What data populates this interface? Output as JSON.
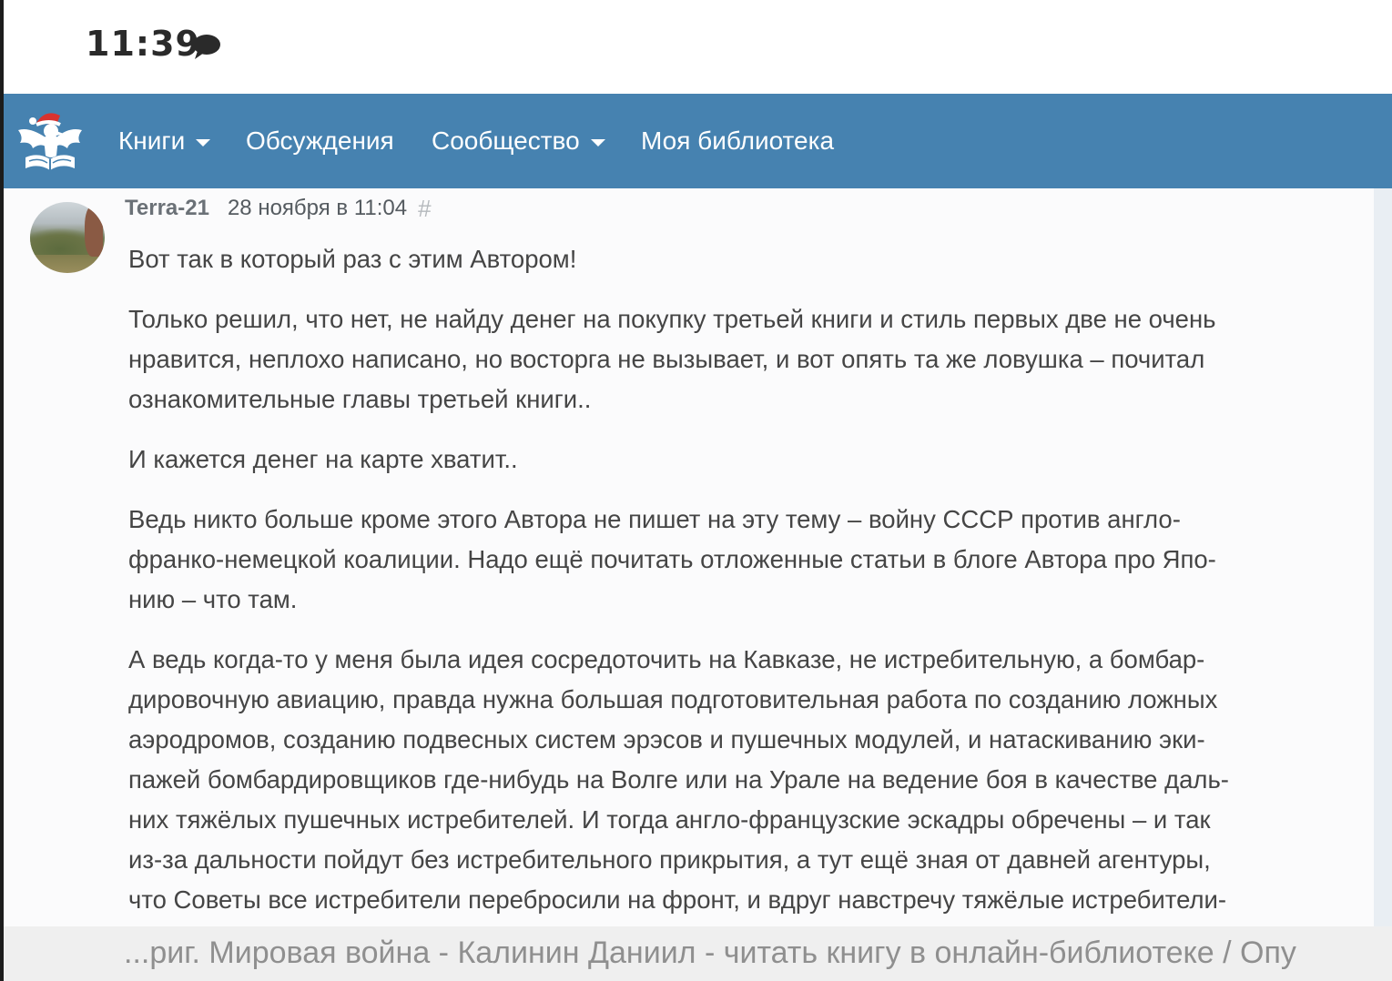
{
  "status_bar": {
    "time": "11:39",
    "notification_icon": "chat-bubble-icon"
  },
  "navbar": {
    "logo_icon": "eagle-book-logo-icon",
    "items": [
      {
        "label": "Книги",
        "has_dropdown": true
      },
      {
        "label": "Обсуждения",
        "has_dropdown": false
      },
      {
        "label": "Сообщество",
        "has_dropdown": true
      },
      {
        "label": "Моя библиотека",
        "has_dropdown": false
      }
    ],
    "background": "#4682b0"
  },
  "comment": {
    "author": "Terra-21",
    "date": "28 ноября в 11:04",
    "permalink": "#",
    "lines": [
      [
        "Вот так в который раз с этим Автором!"
      ],
      [
        "Только решил, что нет, не найду денег на покупку третьей книги и стиль первых две не очень",
        "нравится, неплохо написано, но восторга не вызывает, и вот опять та же ловушка – почитал",
        "ознакомительные главы третьей книги.."
      ],
      [
        "И кажется денег на карте хватит.."
      ],
      [
        "Ведь никто больше кроме этого Автора не пишет на эту тему – войну СССР против англо-",
        "франко-немецкой коалиции. Надо ещё почитать отложенные статьи в блоге Автора про Япо-",
        "нию – что там."
      ],
      [
        "А ведь когда-то у меня была идея сосредоточить на Кавказе, не истребительную, а бомбар-",
        "дировочную авиацию, правда нужна большая подготовительная работа по созданию ложных",
        "аэродромов, созданию подвесных систем эрэсов и пушечных модулей, и натаскиванию эки-",
        "пажей бомбардировщиков где-нибудь на Волге или на Урале на ведение боя в качестве даль-",
        "них тяжёлых пушечных истребителей. И тогда англо-французские эскадры обречены – и так",
        "из-за дальности пойдут без истребительного прикрытия, а тут ещё зная от давней агентуры,",
        "что Советы все истребители перебросили на фронт, и вдруг навстречу тяжёлые истребители-"
      ]
    ]
  },
  "page_title_bar": {
    "text": "...риг. Мировая война - Калинин Даниил - читать книгу в онлайн-библиотеке / Опу"
  }
}
